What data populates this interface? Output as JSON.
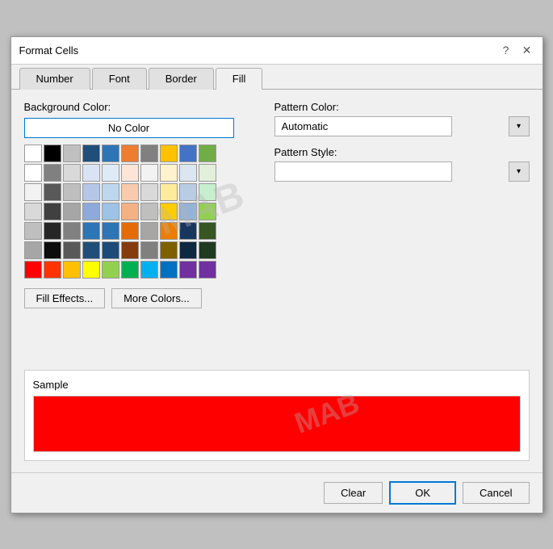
{
  "dialog": {
    "title": "Format Cells",
    "help_icon": "?",
    "close_icon": "✕"
  },
  "tabs": [
    {
      "label": "Number",
      "active": false
    },
    {
      "label": "Font",
      "active": false
    },
    {
      "label": "Border",
      "active": false
    },
    {
      "label": "Fill",
      "active": true
    }
  ],
  "fill_tab": {
    "bg_color_label": "Background Color:",
    "no_color_btn": "No Color",
    "pattern_color_label": "Pattern Color:",
    "pattern_color_value": "Automatic",
    "pattern_style_label": "Pattern Style:",
    "pattern_style_value": "",
    "fill_effects_btn": "Fill Effects...",
    "more_colors_btn": "More Colors...",
    "sample_label": "Sample",
    "sample_color": "#ff0000"
  },
  "bottom_bar": {
    "clear_btn": "Clear",
    "ok_btn": "OK",
    "cancel_btn": "Cancel"
  },
  "color_rows": [
    [
      "#ffffff",
      "#000000",
      "#c0c0c0",
      "#1f4e79",
      "#2e75b6",
      "#ed7d31",
      "#808080",
      "#ffc000",
      "#4472c4",
      "#70ad47"
    ],
    [
      "#ffffff",
      "#808080",
      "#d9d9d9",
      "#dae3f3",
      "#deebf7",
      "#fce4d6",
      "#f2f2f2",
      "#fff2cc",
      "#dce6f1",
      "#e2efda"
    ],
    [
      "#f2f2f2",
      "#595959",
      "#bfbfbf",
      "#b4c7e7",
      "#bdd7ee",
      "#f8cbad",
      "#d9d9d9",
      "#ffeb9c",
      "#b8cce4",
      "#c6efce"
    ],
    [
      "#d9d9d9",
      "#404040",
      "#a6a6a6",
      "#8eaadb",
      "#9dc3e6",
      "#f4b183",
      "#bfbfbf",
      "#ffcc00",
      "#95b3d7",
      "#92d050"
    ],
    [
      "#bfbfbf",
      "#262626",
      "#808080",
      "#2e75b6",
      "#2e75b6",
      "#e36c09",
      "#a6a6a6",
      "#ed7d00",
      "#17375e",
      "#375623"
    ],
    [
      "#a6a6a6",
      "#0d0d0d",
      "#595959",
      "#1f4e79",
      "#1e4a79",
      "#843c0c",
      "#808080",
      "#7f6000",
      "#0e2841",
      "#1e3a20"
    ],
    [
      "#ff0000",
      "#ff3300",
      "#ffc000",
      "#ffff00",
      "#92d050",
      "#00b050",
      "#00b0f0",
      "#0070c0",
      "#7030a0",
      "#7030a0"
    ]
  ]
}
